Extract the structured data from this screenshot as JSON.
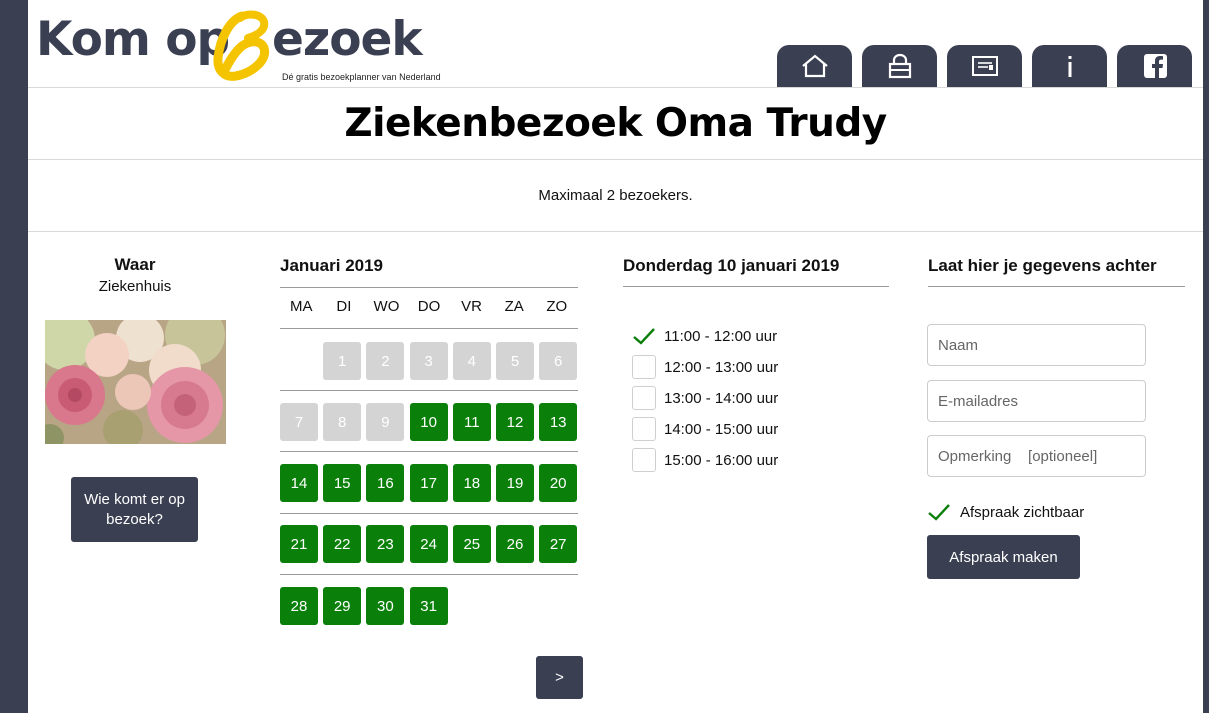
{
  "brand": {
    "logo_part1": "Kom op",
    "logo_part2": "ezoek",
    "tagline": "Dé gratis bezoekplanner van Nederland",
    "accent_color": "#f5c400",
    "nav_color": "#3a3f52"
  },
  "nav": {
    "tabs": [
      {
        "icon": "home-icon"
      },
      {
        "icon": "lock-icon"
      },
      {
        "icon": "contact-card-icon"
      },
      {
        "icon": "info-icon"
      },
      {
        "icon": "facebook-icon"
      }
    ]
  },
  "page": {
    "title": "Ziekenbezoek Oma Trudy",
    "info": "Maximaal 2 bezoekers."
  },
  "waar": {
    "title": "Waar",
    "place": "Ziekenhuis",
    "visitors_button": "Wie komt er op bezoek?"
  },
  "calendar": {
    "month": "Januari 2019",
    "weekdays": [
      "MA",
      "DI",
      "WO",
      "DO",
      "VR",
      "ZA",
      "ZO"
    ],
    "weeks": [
      [
        null,
        "1",
        "2",
        "3",
        "4",
        "5",
        "6"
      ],
      [
        "7",
        "8",
        "9",
        "10",
        "11",
        "12",
        "13"
      ],
      [
        "14",
        "15",
        "16",
        "17",
        "18",
        "19",
        "20"
      ],
      [
        "21",
        "22",
        "23",
        "24",
        "25",
        "26",
        "27"
      ],
      [
        "28",
        "29",
        "30",
        "31",
        null,
        null,
        null
      ]
    ],
    "first_available_day": 10,
    "available_color": "#0a7f0a",
    "past_color": "#d4d4d4",
    "next_button": ">"
  },
  "slots": {
    "date": "Donderdag 10 januari 2019",
    "items": [
      {
        "label": "11:00 - 12:00 uur",
        "checked": true
      },
      {
        "label": "12:00 - 13:00 uur",
        "checked": false
      },
      {
        "label": "13:00 - 14:00 uur",
        "checked": false
      },
      {
        "label": "14:00 - 15:00 uur",
        "checked": false
      },
      {
        "label": "15:00 - 16:00 uur",
        "checked": false
      }
    ]
  },
  "form": {
    "title": "Laat hier je gegevens achter",
    "name_placeholder": "Naam",
    "email_placeholder": "E-mailadres",
    "remark_placeholder": "Opmerking    [optioneel]",
    "visible_label": "Afspraak zichtbaar",
    "visible_checked": true,
    "submit": "Afspraak maken"
  }
}
